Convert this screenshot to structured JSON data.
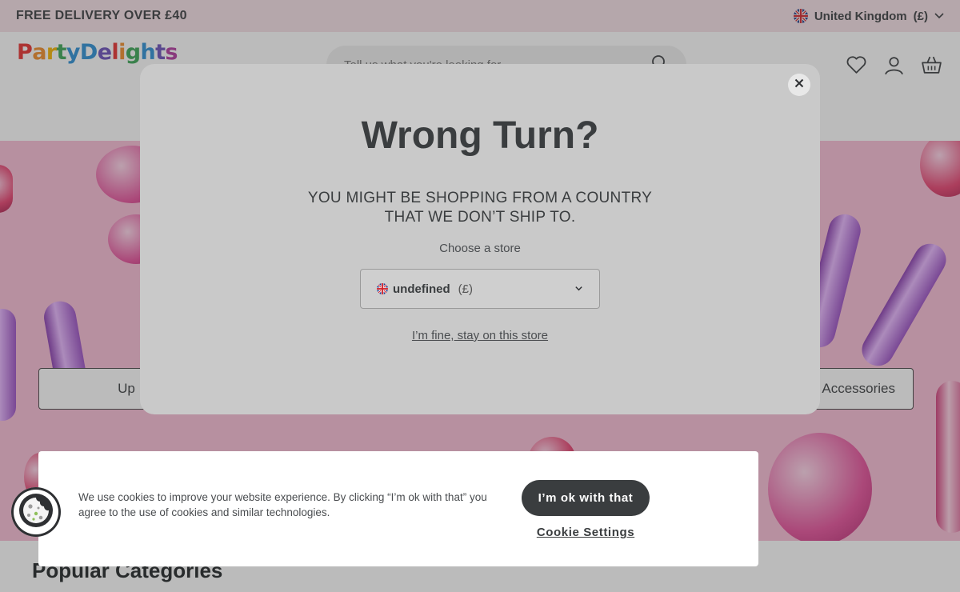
{
  "topbar": {
    "promo": "FREE DELIVERY OVER £40",
    "country": "United Kingdom",
    "currency": "(£)"
  },
  "header": {
    "logo_letters": [
      "P",
      "a",
      "r",
      "t",
      "y",
      "D",
      "e",
      "l",
      "i",
      "g",
      "h",
      "t",
      "s"
    ],
    "logo_colors": [
      "#e8302f",
      "#f28c28",
      "#f4b400",
      "#3aa655",
      "#2a8fd6",
      "#2a8fd6",
      "#6b4fbb",
      "#e8302f",
      "#f28c28",
      "#3aa655",
      "#2a8fd6",
      "#6b4fbb",
      "#b23aa0"
    ],
    "search_placeholder": "Tell us what you're looking for",
    "icons": [
      "heart-icon",
      "user-icon",
      "basket-icon"
    ]
  },
  "hero": {
    "left_button": "Up",
    "right_button": "Accessories"
  },
  "popular_title": "Popular Categories",
  "modal": {
    "title": "Wrong Turn?",
    "message_line1": "YOU MIGHT BE SHOPPING FROM A COUNTRY",
    "message_line2": "THAT WE DON’T SHIP TO.",
    "choose_label": "Choose a store",
    "store_name": "undefined",
    "store_currency": "(£)",
    "stay_link": "I’m fine, stay on this store"
  },
  "cookie": {
    "text": "We use cookies to improve your website experience. By clicking “I’m ok with that” you agree to the use of cookies and similar technologies.",
    "ok_button": "I’m ok with that",
    "settings_link": "Cookie Settings"
  },
  "colors": {
    "topbar_bg": "#f6e0e6",
    "hero_bg": "#f9bdd6",
    "button_dark": "#3a3d3f"
  }
}
